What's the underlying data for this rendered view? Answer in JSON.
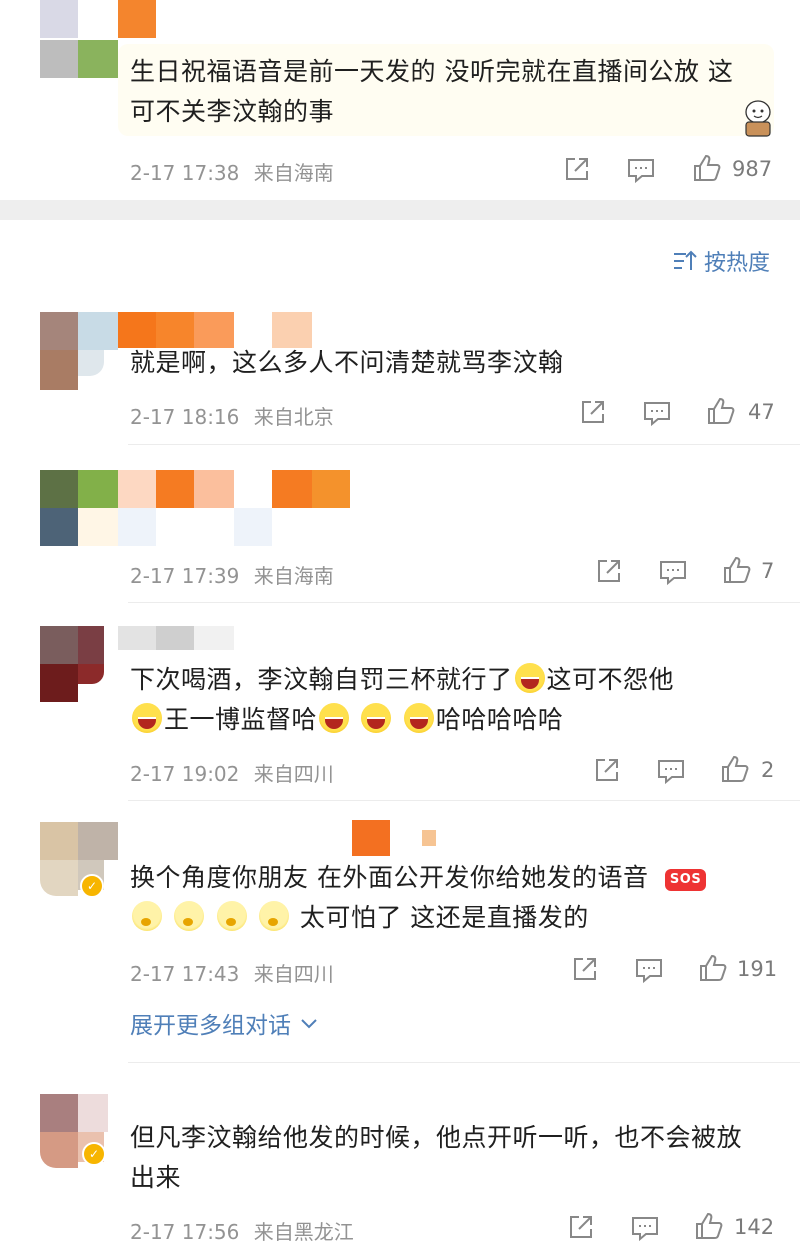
{
  "top_comment": {
    "text": "生日祝福语音是前一天发的 没听完就在直播间公放 这可不关李汶翰的事",
    "time": "2-17 17:38",
    "location": "来自海南",
    "likes": "987"
  },
  "sort": {
    "label": "按热度"
  },
  "comments": [
    {
      "text": "就是啊，这么多人不问清楚就骂李汶翰",
      "time": "2-17 18:16",
      "location": "来自北京",
      "likes": "47"
    },
    {
      "text": "",
      "time": "2-17 17:39",
      "location": "来自海南",
      "likes": "7"
    },
    {
      "text_a": "下次喝酒，李汶翰自罚三杯就行了",
      "text_b": "这可不怨他",
      "text_c": "王一博监督哈",
      "text_d": "哈哈哈哈哈",
      "time": "2-17 19:02",
      "location": "来自四川",
      "likes": "2"
    },
    {
      "text_a": "换个角度你朋友 在外面公开发你给她发的语音",
      "sos": "SOS",
      "text_b": "太可怕了 这还是直播发的",
      "time": "2-17 17:43",
      "location": "来自四川",
      "likes": "191",
      "expand": "展开更多组对话"
    },
    {
      "text": "但凡李汶翰给他发的时候，他点开听一听，也不会被放出来",
      "time": "2-17 17:56",
      "location": "来自黑龙江",
      "likes": "142"
    }
  ],
  "icons": {
    "share": "share-icon",
    "comment": "comment-icon",
    "like": "like-icon",
    "sort": "sort-icon",
    "expand": "chevron-down-icon"
  },
  "colors": {
    "link": "#4f7fb8",
    "meta": "#939393",
    "divider": "#ececec"
  }
}
